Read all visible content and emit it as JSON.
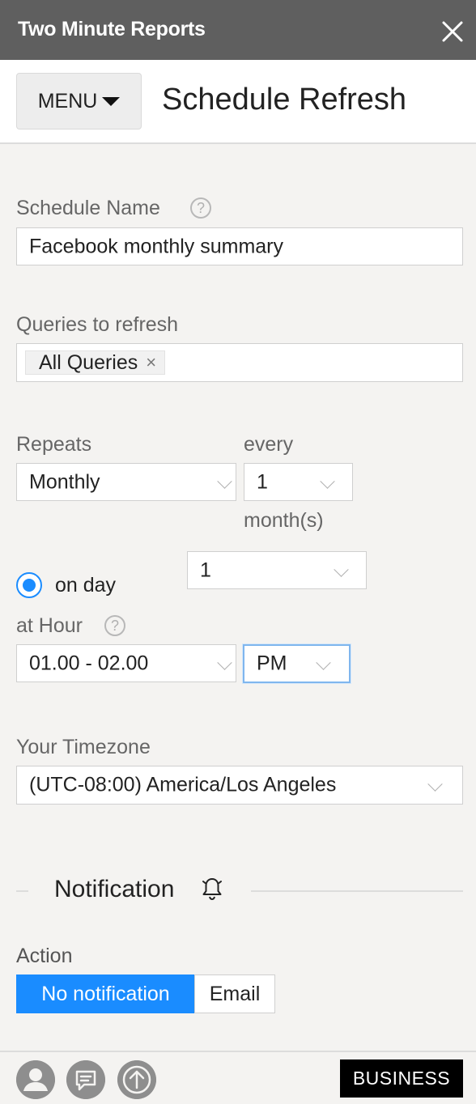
{
  "window": {
    "title": "Two Minute Reports"
  },
  "header": {
    "menu_label": "MENU",
    "page_title": "Schedule Refresh"
  },
  "form": {
    "schedule_name": {
      "label": "Schedule Name",
      "value": "Facebook monthly summary"
    },
    "queries": {
      "label": "Queries to refresh",
      "tags": [
        "All Queries"
      ],
      "remove_glyph": "×"
    },
    "repeats": {
      "label": "Repeats",
      "value": "Monthly"
    },
    "every": {
      "label": "every",
      "value": "1",
      "unit": "month(s)"
    },
    "on_day": {
      "label": "on day",
      "selected": true,
      "value": "1"
    },
    "at_hour": {
      "label": "at Hour",
      "range": "01.00 - 02.00",
      "ampm": "PM"
    },
    "timezone": {
      "label": "Your Timezone",
      "value": "(UTC-08:00) America/Los Angeles"
    }
  },
  "notification": {
    "section_title": "Notification",
    "icon": "bell-icon",
    "action_label": "Action",
    "options": [
      "No notification",
      "Email"
    ],
    "selected": "No notification"
  },
  "footer": {
    "icons": [
      "user-icon",
      "chat-icon",
      "upload-icon"
    ],
    "plan_badge": "BUSINESS"
  },
  "colors": {
    "accent": "#1a8cff",
    "titlebar": "#5f5f5f"
  }
}
